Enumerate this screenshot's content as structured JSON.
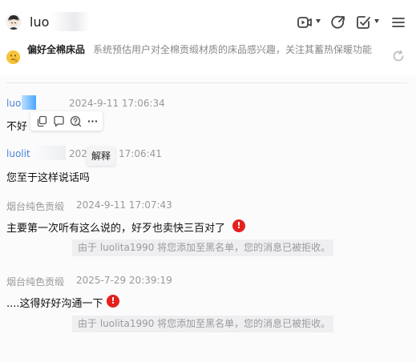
{
  "header": {
    "title": "luo",
    "icons": [
      "video-call-icon",
      "share-icon",
      "task-icon",
      "menu-icon"
    ]
  },
  "notice": {
    "tag": "偏好全棉床品",
    "text": "系统预估用户对全棉贡缎材质的床品感兴趣，关注其蓄热保暖功能"
  },
  "toolbar": {
    "tooltip": "解释"
  },
  "messages": [
    {
      "name": "luo",
      "time": "2024-9-11 17:06:34",
      "text": "不好"
    },
    {
      "name": "luolit",
      "time": "202",
      "time_tail": "17:06:41",
      "text": "您至于这样说话吗"
    },
    {
      "name": "烟台纯色贡缎",
      "time": "2024-9-11 17:07:43",
      "text": "主要第一次听有这么说的，好歹也卖快三百对了",
      "error": "!",
      "system": "由于 luolita1990 将您添加至黑名单，您的消息已被拒收。"
    },
    {
      "name": "烟台纯色贡缎",
      "time": "2025-7-29 20:39:19",
      "text": "....这得好好沟通一下",
      "error": "!",
      "system": "由于 luolita1990 将您添加至黑名单，您的消息已被拒收。"
    }
  ],
  "colors": {
    "link_blue": "#4a83d8",
    "error_red": "#e5201d",
    "system_bg": "#efeff2"
  }
}
